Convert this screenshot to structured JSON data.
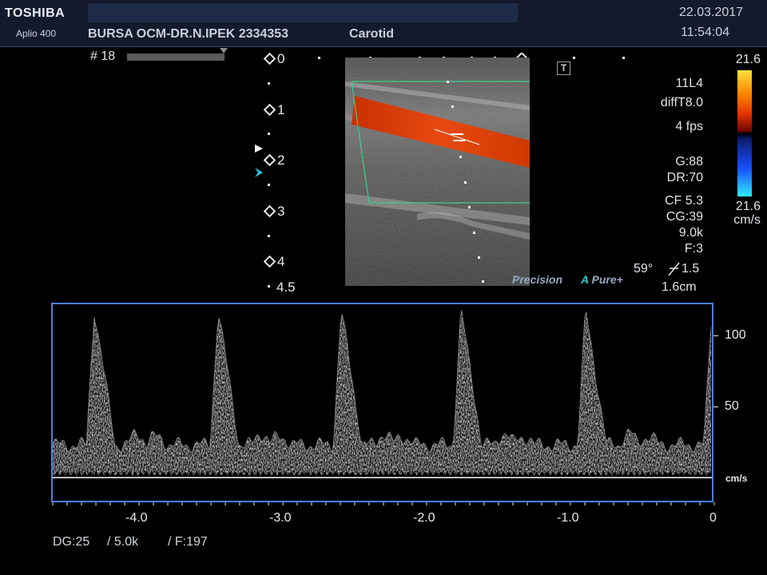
{
  "header": {
    "brand": "TOSHIBA",
    "model": "Aplio 400",
    "patient": "BURSA OCM-DR.N.IPEK 2334353",
    "exam": "Carotid",
    "date": "22.03.2017",
    "time": "11:54:04"
  },
  "image_panel": {
    "frame_label": "# 18",
    "depth_labels": [
      "0",
      "1",
      "2",
      "3",
      "4",
      "4.5"
    ],
    "t_button": "T",
    "precision_logo": "Precision",
    "pure_logo": "Pure+",
    "pure_logo_prefix": "A",
    "angle": "59°",
    "cursor_angle": "1.5",
    "gate_size": "1.6cm"
  },
  "params": {
    "transducer": "11L4",
    "mode": "diffT8.0",
    "fps": "4 fps",
    "gain": "G:88",
    "dynamic_range": "DR:70",
    "cf": "CF 5.3",
    "cg": "CG:39",
    "prf": "9.0k",
    "filter": "F:3"
  },
  "color_bar": {
    "top_value": "21.6",
    "bottom_value": "21.6",
    "unit": "cm/s",
    "colors": [
      "#ffe040",
      "#ff5a00",
      "#b01400",
      "#1a0000",
      "#000010",
      "#1028a0",
      "#1a60ff",
      "#20e0ff"
    ]
  },
  "doppler": {
    "y_ticks": [
      "100",
      "50"
    ],
    "y_unit": "cm/s",
    "x_ticks": [
      "-4.0",
      "-3.0",
      "-2.0",
      "-1.0",
      "0"
    ],
    "info_dg": "DG:25",
    "info_prf": "/ 5.0k",
    "info_f": "/ F:197",
    "frame_color": "#4d7fe0"
  }
}
